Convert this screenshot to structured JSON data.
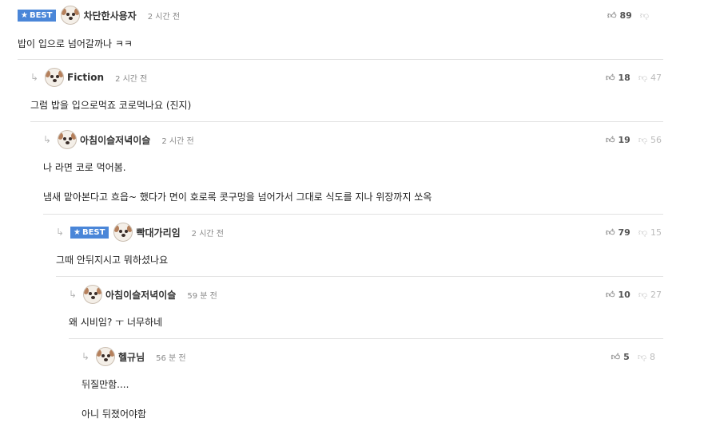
{
  "comments": [
    {
      "best": "BEST",
      "nick": "차단한사용자",
      "time": "2 시간 전",
      "up": "89",
      "down": "",
      "lines": [
        "밥이 입으로 넘어갈까나 ㅋㅋ"
      ]
    },
    {
      "best": "",
      "nick": "Fiction",
      "time": "2 시간 전",
      "up": "18",
      "down": "47",
      "lines": [
        "그럼 밥을 입으로먹죠 코로먹나요 (진지)"
      ]
    },
    {
      "best": "",
      "nick": "아침이슬저녁이슬",
      "time": "2 시간 전",
      "up": "19",
      "down": "56",
      "lines": [
        "나 라면 코로 먹어봄.",
        "냄새 맡아본다고 흐읍~ 했다가 면이 호로록 콧구멍을 넘어가서 그대로 식도를 지나 위장까지 쏘옥"
      ]
    },
    {
      "best": "BEST",
      "nick": "빡대가리임",
      "time": "2 시간 전",
      "up": "79",
      "down": "15",
      "lines": [
        "그때 안뒤지시고 뭐하셨나요"
      ]
    },
    {
      "best": "",
      "nick": "아침이슬저녁이슬",
      "time": "59 분 전",
      "up": "10",
      "down": "27",
      "lines": [
        "왜 시비임? ㅜ 너무하네"
      ]
    },
    {
      "best": "",
      "nick": "헬규님",
      "time": "56 분 전",
      "up": "5",
      "down": "8",
      "lines": [
        "뒤질만함....",
        "아니 뒤졌어야함"
      ]
    }
  ],
  "icons": {
    "reply": "reply-arrow-icon",
    "up": "thumbs-up-icon",
    "down": "thumbs-down-icon",
    "star": "star-icon"
  },
  "colors": {
    "best_badge": "#4a86d8"
  }
}
